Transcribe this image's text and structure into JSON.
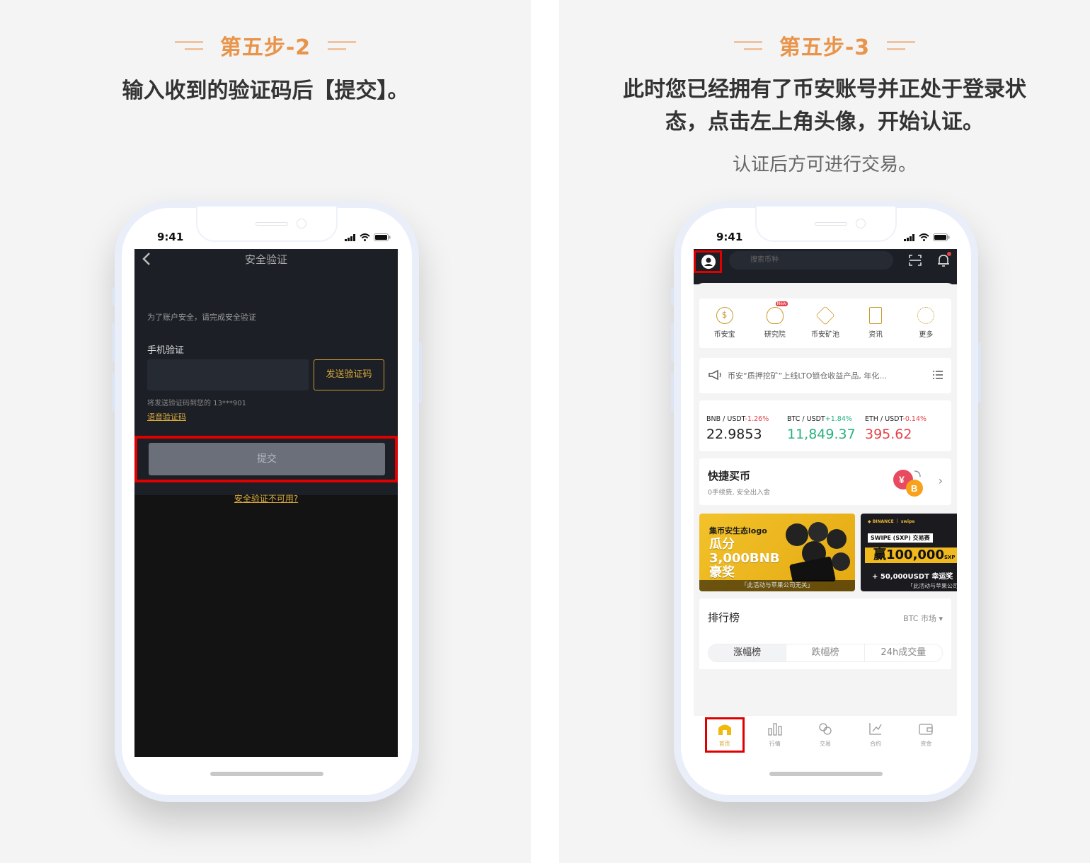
{
  "left": {
    "step_title": "第五步-2",
    "instruction": "输入收到的验证码后【提交】。",
    "phone": {
      "time": "9:41",
      "nav_title": "安全验证",
      "back_icon": "chevron-left-icon",
      "security_hint": "为了账户安全，请完成安全验证",
      "phone_verify_label": "手机验证",
      "code_input_value": "",
      "send_code_label": "发送验证码",
      "sent_to_text": "将发送验证码到您的 13***901",
      "voice_code_link": "语音验证码",
      "submit_label": "提交",
      "unavailable_link": "安全验证不可用?"
    }
  },
  "right": {
    "step_title": "第五步-3",
    "instruction_line1": "此时您已经拥有了币安账号并正处于登录状",
    "instruction_line2": "态，点击左上角头像，开始认证。",
    "sub_instruction": "认证后方可进行交易。",
    "phone": {
      "time": "9:41",
      "search_placeholder": "搜索币种",
      "shortcuts": [
        {
          "label": "币安宝",
          "icon": "dollar-coin-icon"
        },
        {
          "label": "研究院",
          "icon": "bulb-icon",
          "badge": "New"
        },
        {
          "label": "币安矿池",
          "icon": "bnb-cube-icon"
        },
        {
          "label": "资讯",
          "icon": "news-icon"
        },
        {
          "label": "更多",
          "icon": "more-dots-icon"
        }
      ],
      "notice_text": "币安“质押挖矿”上线LTO锁仓收益产品, 年化...",
      "tickers": [
        {
          "pair": "BNB / USDT",
          "change": "-1.26%",
          "price": "22.9853",
          "price_color": "#222222",
          "change_color": "#e5424a"
        },
        {
          "pair": "BTC / USDT",
          "change": "+1.84%",
          "price": "11,849.37",
          "price_color": "#26b37b",
          "change_color": "#26b37b"
        },
        {
          "pair": "ETH / USDT",
          "change": "-0.14%",
          "price": "395.62",
          "price_color": "#e5424a",
          "change_color": "#e5424a"
        }
      ],
      "quick_buy_title": "快捷买币",
      "quick_buy_sub": "0手续费, 安全出入金",
      "banner1": {
        "small": "集币安生态logo",
        "line1": "瓜分",
        "line2": "3,000BNB",
        "line3": "豪奖",
        "footer": "「此活动与苹果公司无关」"
      },
      "banner2": {
        "brand": "◆ BINANCE ｜ swipe",
        "tag": "SWIPE (SXP) 交易赛",
        "prize": "赢100,000",
        "prize_unit": "SXP",
        "sub": "+ 50,000USDT 幸运奖",
        "footer": "「此活动与苹果公司"
      },
      "rank_title": "排行榜",
      "rank_market": "BTC 市场 ▾",
      "rank_tabs": [
        "涨幅榜",
        "跌幅榜",
        "24h成交量"
      ],
      "tabs": [
        {
          "label": "首页",
          "icon": "home-icon"
        },
        {
          "label": "行情",
          "icon": "bar-chart-icon"
        },
        {
          "label": "交易",
          "icon": "exchange-icon"
        },
        {
          "label": "合约",
          "icon": "futures-icon"
        },
        {
          "label": "资金",
          "icon": "wallet-icon"
        }
      ]
    }
  },
  "colors": {
    "step_accent": "#e8944a",
    "highlight_red": "#e00000",
    "binance_gold": "#d8a93a"
  }
}
